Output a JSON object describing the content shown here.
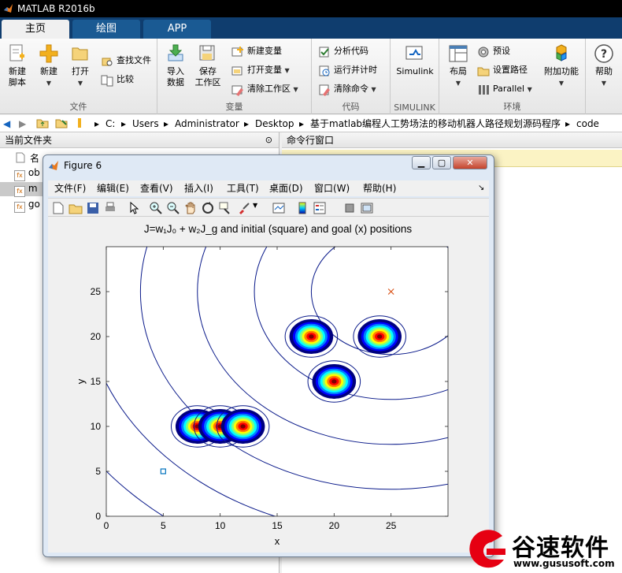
{
  "app": {
    "title": "MATLAB R2016b"
  },
  "tabs": [
    {
      "label": "主页",
      "active": true
    },
    {
      "label": "绘图",
      "active": false
    },
    {
      "label": "APP",
      "active": false
    }
  ],
  "ribbon": {
    "file": {
      "label": "文件",
      "new_script": "新建\n脚本",
      "new": "新建",
      "open": "打开",
      "find_files": "查找文件",
      "compare": "比较"
    },
    "variable": {
      "label": "变量",
      "import_data": "导入\n数据",
      "save_workspace": "保存\n工作区",
      "new_variable": "新建变量",
      "open_variable": "打开变量",
      "clear_workspace": "清除工作区"
    },
    "code": {
      "label": "代码",
      "analyze_code": "分析代码",
      "run_and_time": "运行并计时",
      "clear_commands": "清除命令"
    },
    "simulink": {
      "label": "SIMULINK",
      "simulink": "Simulink"
    },
    "environment": {
      "label": "环境",
      "layout": "布局",
      "preferences": "预设",
      "set_path": "设置路径",
      "parallel": "Parallel",
      "addons": "附加功能"
    },
    "help": {
      "label": "帮助"
    }
  },
  "address": [
    "C:",
    "Users",
    "Administrator",
    "Desktop",
    "基于matlab编程人工势场法的移动机器人路径规划源码程序",
    "code"
  ],
  "left_pane": {
    "header": "当前文件夹",
    "col_header": "名",
    "files": [
      "ob",
      "m",
      "go"
    ]
  },
  "right_pane": {
    "header": "命令行窗口"
  },
  "figure": {
    "title": "Figure 6",
    "menus": [
      "文件(F)",
      "编辑(E)",
      "查看(V)",
      "插入(I)",
      "工具(T)",
      "桌面(D)",
      "窗口(W)",
      "帮助(H)"
    ]
  },
  "chart_data": {
    "type": "contour",
    "title": "J=w₁J₀ + w₂J_g and initial (square) and goal (x) positions",
    "xlabel": "x",
    "ylabel": "y",
    "xlim": [
      0,
      30
    ],
    "ylim": [
      0,
      30
    ],
    "xticks": [
      0,
      5,
      10,
      15,
      20,
      25
    ],
    "yticks": [
      0,
      5,
      10,
      15,
      20,
      25
    ],
    "obstacles": [
      {
        "x": 8,
        "y": 10
      },
      {
        "x": 10,
        "y": 10
      },
      {
        "x": 12,
        "y": 10
      },
      {
        "x": 18,
        "y": 20
      },
      {
        "x": 24,
        "y": 20
      },
      {
        "x": 20,
        "y": 15
      }
    ],
    "initial": {
      "x": 5,
      "y": 5,
      "marker": "square",
      "color": "#0072bd"
    },
    "goal": {
      "x": 25,
      "y": 25,
      "marker": "x",
      "color": "#d95319"
    },
    "goal_contour_radii": [
      7,
      12,
      17,
      22,
      27,
      32
    ],
    "contour_color": "#0a1a8a"
  },
  "watermark": {
    "brand": "谷速软件",
    "url": "www.gususoft.com",
    "color": "#e60012"
  }
}
